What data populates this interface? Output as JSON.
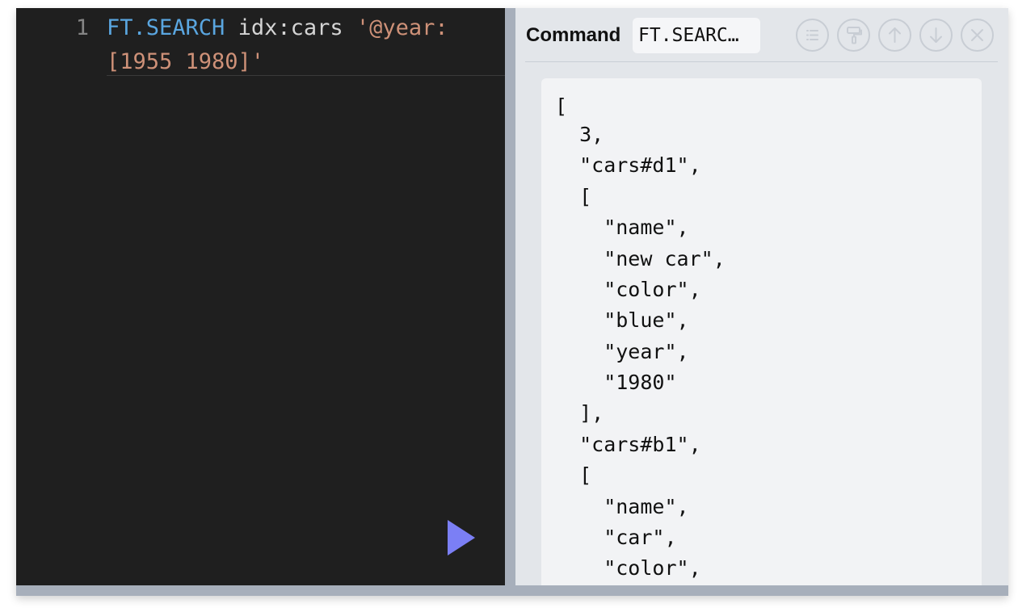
{
  "editor": {
    "line_number": "1",
    "code_line1": {
      "command": "FT.SEARCH",
      "args": " idx:cars ",
      "string_start": "'@year:"
    },
    "code_line2": {
      "string_end": "[1955 1980]'"
    },
    "run_icon": "play-icon"
  },
  "results": {
    "label": "Command",
    "command_preview": "FT.SEARC…",
    "icons": [
      "list-icon",
      "paint-roller-icon",
      "arrow-up-icon",
      "arrow-down-icon",
      "close-icon"
    ],
    "output_lines": [
      "[",
      "  3,",
      "  \"cars#d1\",",
      "  [",
      "    \"name\",",
      "    \"new car\",",
      "    \"color\",",
      "    \"blue\",",
      "    \"year\",",
      "    \"1980\"",
      "  ],",
      "  \"cars#b1\",",
      "  [",
      "    \"name\",",
      "    \"car\",",
      "    \"color\","
    ]
  },
  "colors": {
    "editor_bg": "#1f1f1f",
    "command_token": "#5aa6e0",
    "string_token": "#ce9178",
    "run_button": "#7b7ff5"
  }
}
